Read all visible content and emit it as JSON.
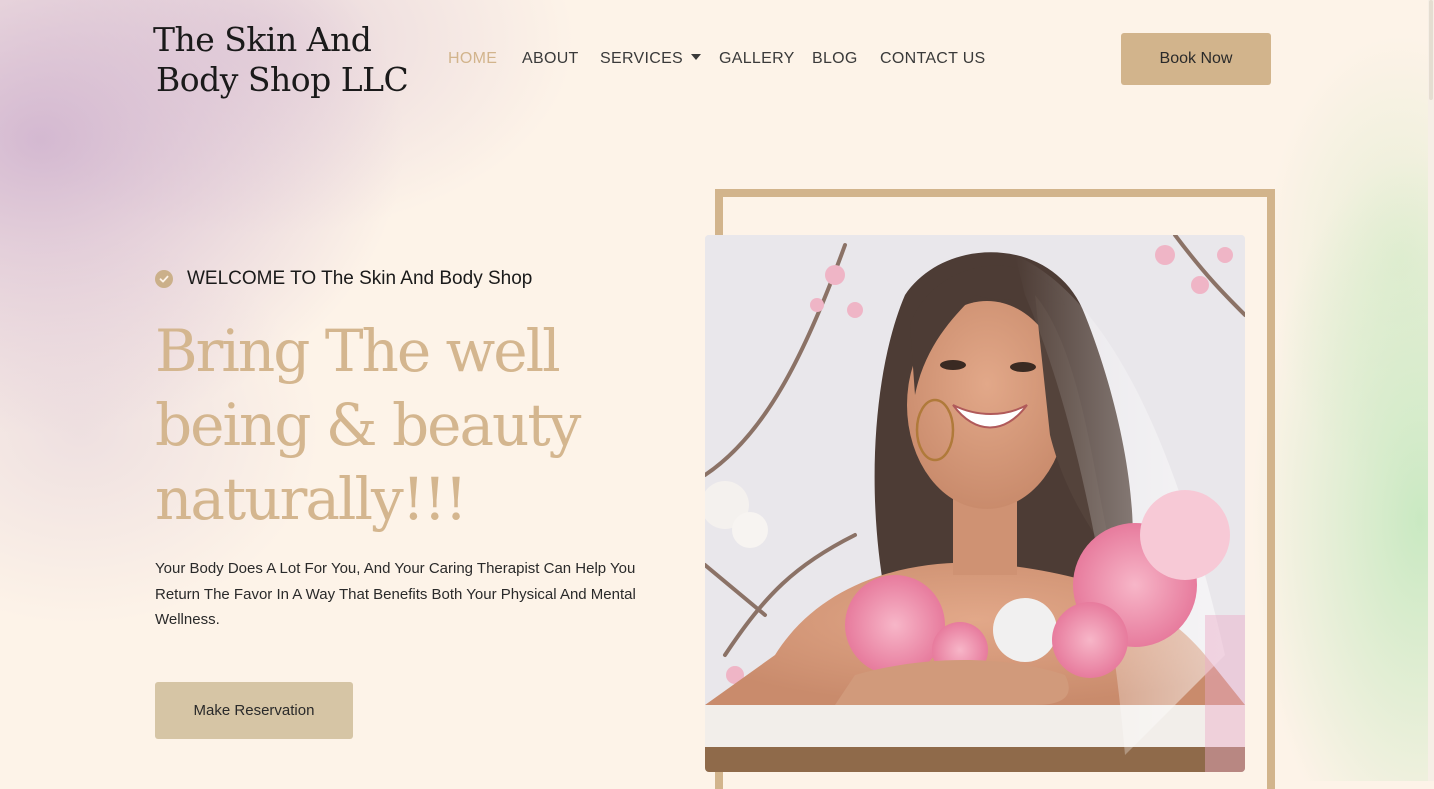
{
  "header": {
    "logo_line1": "The Skin And",
    "logo_line2": "Body Shop LLC",
    "nav": [
      {
        "label": "HOME",
        "active": true
      },
      {
        "label": "ABOUT",
        "active": false
      },
      {
        "label": "SERVICES",
        "active": false,
        "has_dropdown": true
      },
      {
        "label": "GALLERY",
        "active": false
      },
      {
        "label": "BLOG",
        "active": false
      },
      {
        "label": "CONTACT US",
        "active": false
      }
    ],
    "book_button": "Book Now"
  },
  "hero": {
    "welcome": "WELCOME TO The Skin And Body Shop",
    "headline_lines": [
      "Bring The well",
      "being & beauty",
      "naturally!!!"
    ],
    "description_lines": [
      "Your Body Does A Lot For You, And Your Caring Therapist Can Help You",
      "Return The Favor In A Way That Benefits Both Your Physical And Mental",
      "Wellness."
    ],
    "cta_button": "Make Reservation",
    "image_subject": "smiling woman with veil and pink flowers"
  },
  "icons": [
    "check-circle-icon",
    "chevron-down-icon"
  ],
  "colors": {
    "accent": "#d2b48c",
    "headline": "#d4b68f",
    "cta_background": "#d6c5a5",
    "page_background": "#fdf3e8"
  }
}
